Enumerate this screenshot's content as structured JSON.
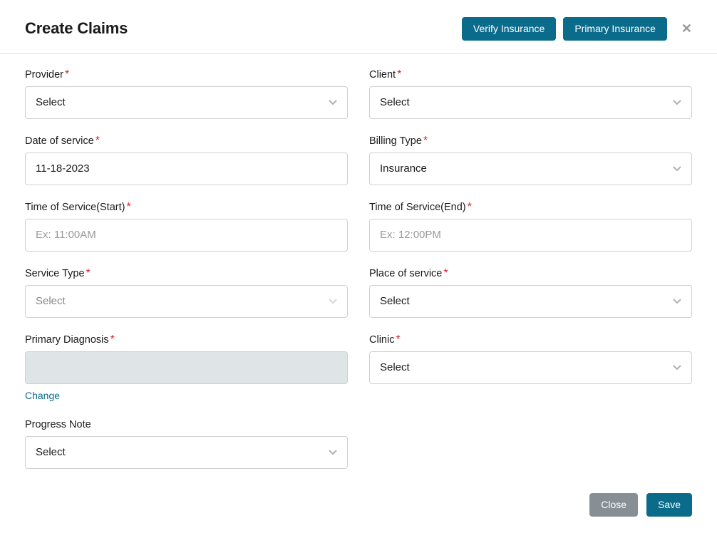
{
  "header": {
    "title": "Create Claims",
    "verify_btn": "Verify Insurance",
    "primary_btn": "Primary Insurance"
  },
  "placeholders": {
    "select": "Select"
  },
  "form": {
    "provider": {
      "label": "Provider",
      "value": "Select",
      "required": true
    },
    "client": {
      "label": "Client",
      "value": "Select",
      "required": true
    },
    "date_of_service": {
      "label": "Date of service",
      "value": "11-18-2023",
      "required": true
    },
    "billing_type": {
      "label": "Billing Type",
      "value": "Insurance",
      "required": true
    },
    "time_start": {
      "label": "Time of Service(Start)",
      "placeholder": "Ex: 11:00AM",
      "value": "",
      "required": true
    },
    "time_end": {
      "label": "Time of Service(End)",
      "placeholder": "Ex: 12:00PM",
      "value": "",
      "required": true
    },
    "service_type": {
      "label": "Service Type",
      "value": "Select",
      "required": true
    },
    "place_of_service": {
      "label": "Place of service",
      "value": "Select",
      "required": true
    },
    "primary_diagnosis": {
      "label": "Primary Diagnosis",
      "value": "",
      "required": true,
      "change_text": "Change"
    },
    "clinic": {
      "label": "Clinic",
      "value": "Select",
      "required": true
    },
    "progress_note": {
      "label": "Progress Note",
      "value": "Select",
      "required": false
    }
  },
  "footer": {
    "close": "Close",
    "save": "Save"
  }
}
